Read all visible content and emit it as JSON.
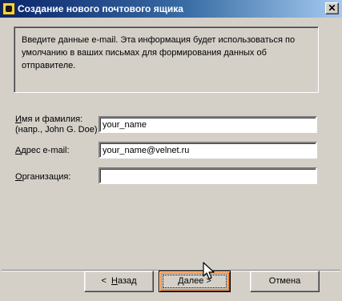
{
  "window": {
    "title": "Создание нового почтового ящика",
    "close_glyph": "✕"
  },
  "info": {
    "text": "Введите данные e-mail. Эта информация будет использоваться по умолчанию в ваших письмах для формирования данных об отправителе."
  },
  "fields": {
    "name": {
      "label_prefix": "",
      "label_accel": "И",
      "label_rest": "мя и фамилия:",
      "hint": "(напр., John G. Doe)",
      "value": "your_name"
    },
    "email": {
      "label_prefix": "",
      "label_accel": "А",
      "label_rest": "дрес e-mail:",
      "value": "your_name@velnet.ru"
    },
    "org": {
      "label_prefix": "",
      "label_accel": "О",
      "label_rest": "рганизация:",
      "value": ""
    }
  },
  "buttons": {
    "back": {
      "arrow": "<",
      "accel": "Н",
      "rest": "азад"
    },
    "next": {
      "accel": "Д",
      "rest": "алее",
      "arrow": ">"
    },
    "cancel": {
      "label": "Отмена"
    }
  },
  "colors": {
    "titlebar_start": "#0a246a",
    "titlebar_end": "#a6caf0",
    "face": "#d4d0c8",
    "hover_outline": "#f58a3c"
  }
}
